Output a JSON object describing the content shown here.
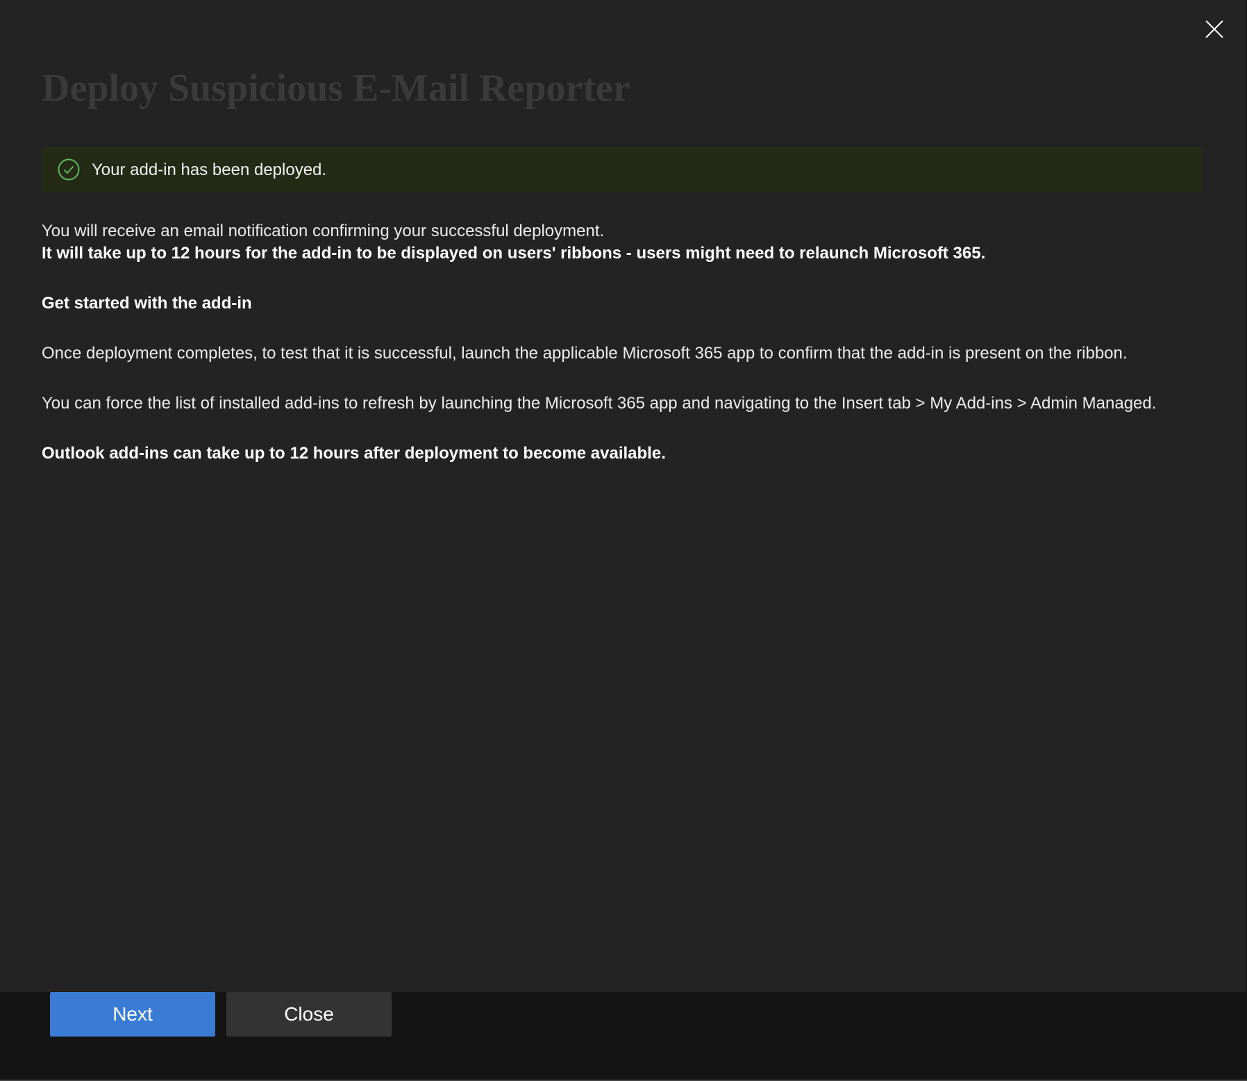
{
  "dialog": {
    "title": "Deploy Suspicious E-Mail Reporter",
    "close_icon": "close-icon"
  },
  "status": {
    "icon": "checkmark-circle-icon",
    "message": "Your add-in has been deployed.",
    "accent_color": "#5cb85c"
  },
  "content": {
    "notification": "You will receive an email notification confirming your successful deployment.",
    "ribbon_notice": "It will take up to 12 hours for the add-in to be displayed on users' ribbons - users might need to relaunch Microsoft 365.",
    "get_started_heading": "Get started with the add-in",
    "test_instructions": "Once deployment completes, to test that it is successful, launch the applicable Microsoft 365 app to confirm that the add-in is present on the ribbon.",
    "refresh_instructions": "You can force the list of installed add-ins to refresh by launching the Microsoft 365 app and navigating to the Insert tab > My Add-ins > Admin Managed.",
    "outlook_notice": "Outlook add-ins can take up to 12 hours after deployment to become available."
  },
  "footer": {
    "next_label": "Next",
    "close_label": "Close",
    "primary_color": "#3a7bd5"
  }
}
